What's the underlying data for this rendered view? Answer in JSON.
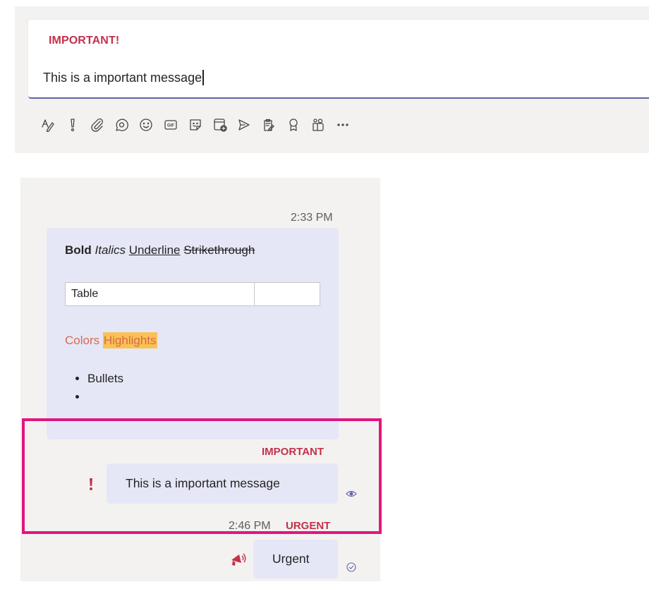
{
  "compose": {
    "importance_label": "IMPORTANT!",
    "message_text": "This is a important message"
  },
  "toolbar": {
    "buttons": [
      {
        "name": "format-icon",
        "label": "Format"
      },
      {
        "name": "importance-icon",
        "label": "Set delivery options"
      },
      {
        "name": "attach-icon",
        "label": "Attach"
      },
      {
        "name": "loop-icon",
        "label": "Loop component"
      },
      {
        "name": "emoji-icon",
        "label": "Emoji"
      },
      {
        "name": "gif-icon",
        "label": "GIF"
      },
      {
        "name": "sticker-icon",
        "label": "Sticker"
      },
      {
        "name": "schedule-meeting-icon",
        "label": "Schedule meeting"
      },
      {
        "name": "stream-icon",
        "label": "Stream"
      },
      {
        "name": "notes-icon",
        "label": "Notes"
      },
      {
        "name": "praise-icon",
        "label": "Praise"
      },
      {
        "name": "app-icon",
        "label": "App"
      },
      {
        "name": "more-options-icon",
        "label": "More options"
      }
    ],
    "gif_label": "GIF"
  },
  "chat": {
    "message1": {
      "time": "2:33 PM",
      "bold": "Bold",
      "italics": "Italics",
      "underline": "Underline",
      "strikethrough": "Strikethrough",
      "table_cell": "Table",
      "colors": "Colors",
      "highlights": "Highlights",
      "bullets": [
        "Bullets",
        ""
      ]
    },
    "message2": {
      "label": "IMPORTANT",
      "text": "This is a important message",
      "status": "seen"
    },
    "message3": {
      "time": "2:46 PM",
      "label": "URGENT",
      "text": "Urgent",
      "status": "delivered"
    }
  },
  "colors": {
    "accent": "#6264a7",
    "important_red": "#c4314b",
    "highlight_box": "#e3157f",
    "bubble": "#e5e7f7",
    "text_color": "#d9694d",
    "highlight_bg": "#f9c253"
  }
}
